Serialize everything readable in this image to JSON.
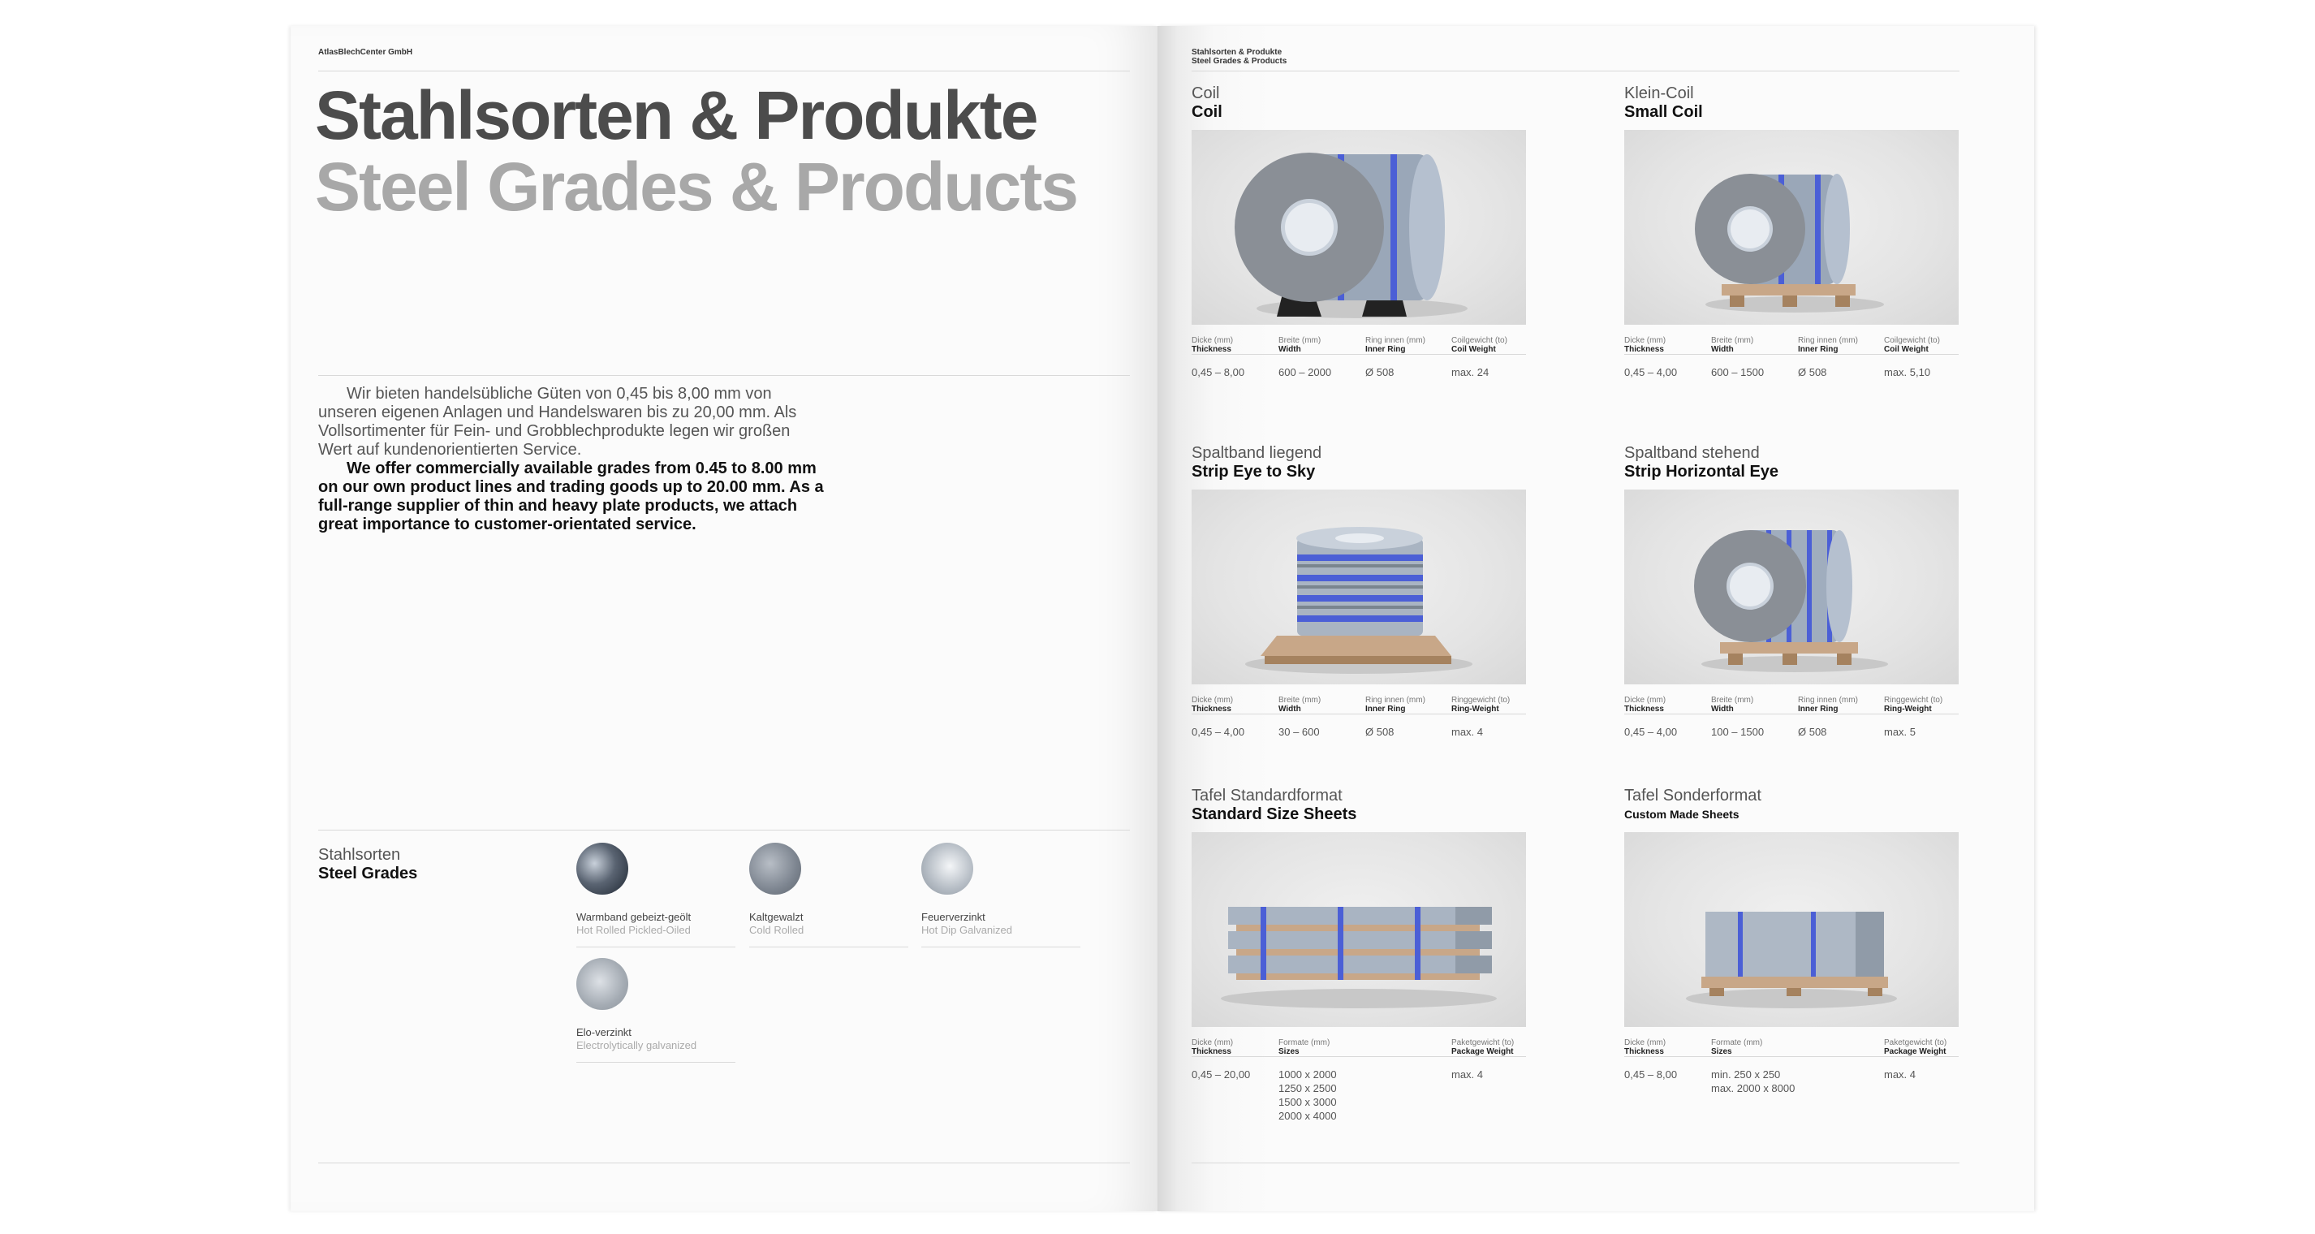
{
  "left_page": {
    "company": "AtlasBlechCenter GmbH",
    "title_de": "Stahlsorten & Produkte",
    "title_en": "Steel Grades & Products",
    "intro_de": "Wir bieten handelsübliche Güten von 0,45 bis 8,00 mm von unseren eigenen Anlagen und Handelswaren bis zu 20,00 mm. Als Vollsortimenter für Fein- und Grobblechprodukte legen wir großen Wert auf kundenorientierten Service.",
    "intro_en": "We offer commercially available grades from 0.45 to 8.00 mm on our own product lines and trading goods up to 20.00 mm. As a full-range supplier of thin and heavy plate products, we attach great importance to customer-orientated service.",
    "grades_heading_de": "Stahlsorten",
    "grades_heading_en": "Steel Grades",
    "grades": [
      {
        "name": "Warmband gebeizt-geölt",
        "sub": "Hot Rolled Pickled-Oiled"
      },
      {
        "name": "Kaltgewalzt",
        "sub": "Cold Rolled"
      },
      {
        "name": "Feuerverzinkt",
        "sub": "Hot Dip Galvanized"
      },
      {
        "name": "Elo-verzinkt",
        "sub": "Electrolytically galvanized"
      }
    ]
  },
  "right_page": {
    "header_de": "Stahlsorten & Produkte",
    "header_en": "Steel Grades & Products",
    "products": [
      {
        "name_de": "Coil",
        "name_en": "Coil",
        "specs": [
          {
            "de": "Dicke (mm)",
            "en": "Thickness",
            "value": "0,45 – 8,00"
          },
          {
            "de": "Breite (mm)",
            "en": "Width",
            "value": "600 – 2000"
          },
          {
            "de": "Ring innen (mm)",
            "en": "Inner Ring",
            "value": "Ø 508"
          },
          {
            "de": "Coilgewicht (to)",
            "en": "Coil Weight",
            "value": "max. 24"
          }
        ]
      },
      {
        "name_de": "Klein-Coil",
        "name_en": "Small Coil",
        "specs": [
          {
            "de": "Dicke (mm)",
            "en": "Thickness",
            "value": "0,45 – 4,00"
          },
          {
            "de": "Breite (mm)",
            "en": "Width",
            "value": "600 – 1500"
          },
          {
            "de": "Ring innen (mm)",
            "en": "Inner Ring",
            "value": "Ø 508"
          },
          {
            "de": "Coilgewicht (to)",
            "en": "Coil Weight",
            "value": "max. 5,10"
          }
        ]
      },
      {
        "name_de": "Spaltband liegend",
        "name_en": "Strip Eye to Sky",
        "specs": [
          {
            "de": "Dicke (mm)",
            "en": "Thickness",
            "value": "0,45 – 4,00"
          },
          {
            "de": "Breite (mm)",
            "en": "Width",
            "value": "30 – 600"
          },
          {
            "de": "Ring innen (mm)",
            "en": "Inner Ring",
            "value": "Ø 508"
          },
          {
            "de": "Ringgewicht (to)",
            "en": "Ring-Weight",
            "value": "max. 4"
          }
        ]
      },
      {
        "name_de": "Spaltband stehend",
        "name_en": "Strip Horizontal Eye",
        "specs": [
          {
            "de": "Dicke (mm)",
            "en": "Thickness",
            "value": "0,45 – 4,00"
          },
          {
            "de": "Breite (mm)",
            "en": "Width",
            "value": "100 – 1500"
          },
          {
            "de": "Ring innen (mm)",
            "en": "Inner Ring",
            "value": "Ø 508"
          },
          {
            "de": "Ringgewicht (to)",
            "en": "Ring-Weight",
            "value": "max. 5"
          }
        ]
      },
      {
        "name_de": "Tafel Standardformat",
        "name_en": "Standard Size Sheets",
        "specs": [
          {
            "de": "Dicke (mm)",
            "en": "Thickness",
            "value": "0,45 – 20,00"
          },
          {
            "de": "Formate (mm)",
            "en": "Sizes",
            "value": "1000 x 2000\n1250 x 2500\n1500 x 3000\n2000 x 4000"
          },
          {
            "de": "",
            "en": "",
            "value": ""
          },
          {
            "de": "Paketgewicht (to)",
            "en": "Package Weight",
            "value": "max. 4"
          }
        ]
      },
      {
        "name_de": "Tafel Sonderformat",
        "name_en": "Custom Made Sheets",
        "specs": [
          {
            "de": "Dicke (mm)",
            "en": "Thickness",
            "value": "0,45 – 8,00"
          },
          {
            "de": "Formate (mm)",
            "en": "Sizes",
            "value": "min. 250 x 250\nmax. 2000 x 8000"
          },
          {
            "de": "",
            "en": "",
            "value": ""
          },
          {
            "de": "Paketgewicht (to)",
            "en": "Package Weight",
            "value": "max. 4"
          }
        ]
      }
    ]
  }
}
